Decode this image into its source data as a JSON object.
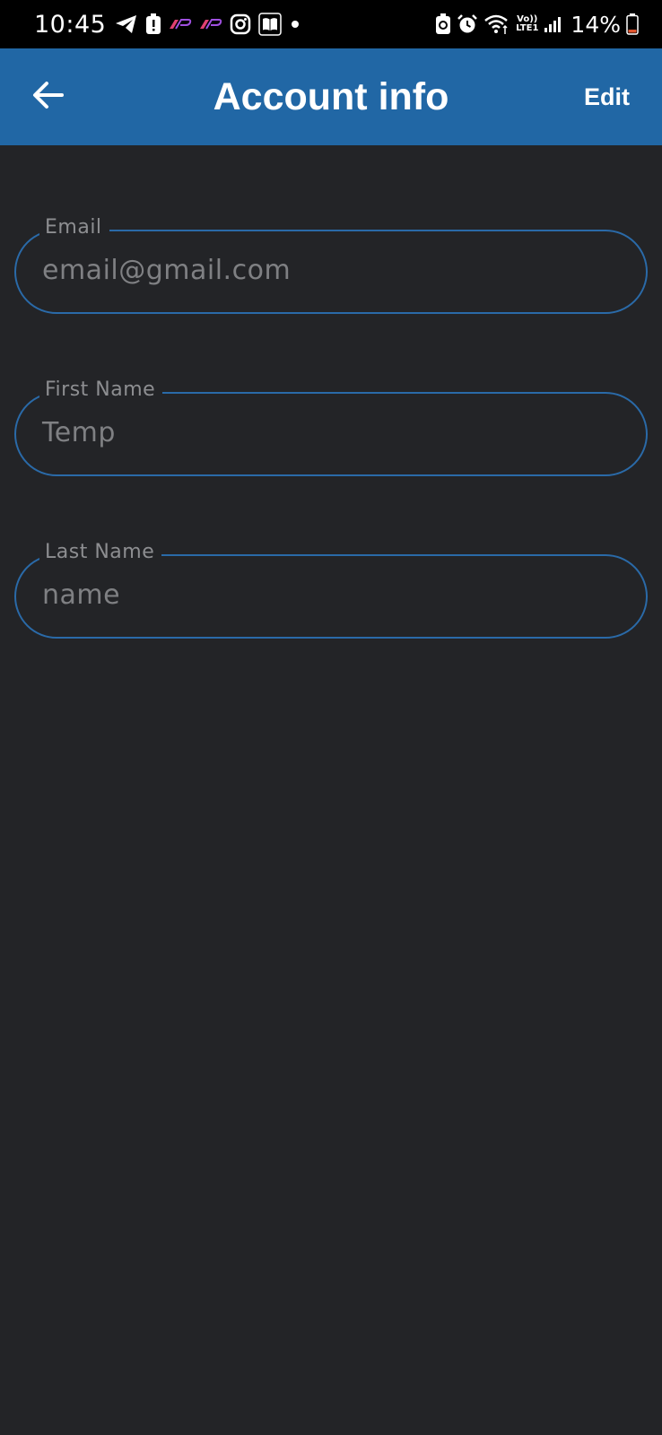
{
  "status_bar": {
    "time": "10:45",
    "battery": "14%",
    "lte_top": "Vo))",
    "lte_bottom": "LTE1",
    "left_icons": [
      "telegram-icon",
      "alert-icon",
      "app-icon",
      "app-icon",
      "instagram-icon",
      "book-icon",
      "dot-icon"
    ],
    "right_icons": [
      "battery-saver-icon",
      "alarm-icon",
      "wifi-icon",
      "signal-icon",
      "battery-icon"
    ]
  },
  "app_bar": {
    "title": "Account info",
    "edit_label": "Edit",
    "back_icon": "arrow-left-icon",
    "background": "#2167a5"
  },
  "form": {
    "email": {
      "label": "Email",
      "value": "email@gmail.com"
    },
    "first_name": {
      "label": "First Name",
      "value": "Temp"
    },
    "last_name": {
      "label": "Last Name",
      "value": "name"
    }
  },
  "colors": {
    "background": "#232427",
    "outline": "#2a6aa8",
    "label": "#8d8e91",
    "value": "#7f8083"
  }
}
